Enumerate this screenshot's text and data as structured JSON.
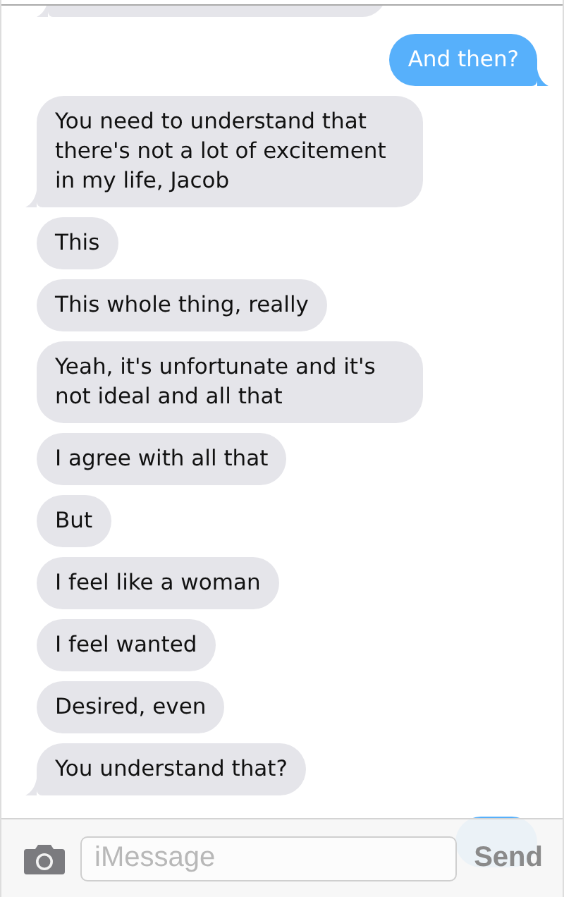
{
  "messages": [
    {
      "kind": "sent",
      "text": "And then?",
      "tail": true
    },
    {
      "kind": "received",
      "text": "You need to understand that there's not a lot of excitement in my life, Jacob",
      "tail": true
    },
    {
      "kind": "received",
      "text": "This",
      "tail": false
    },
    {
      "kind": "received",
      "text": "This whole thing, really",
      "tail": false
    },
    {
      "kind": "received",
      "text": "Yeah, it's unfortunate and it's not ideal and all that",
      "tail": false
    },
    {
      "kind": "received",
      "text": "I agree with all that",
      "tail": false
    },
    {
      "kind": "received",
      "text": "But",
      "tail": false
    },
    {
      "kind": "received",
      "text": "I feel like a woman",
      "tail": false
    },
    {
      "kind": "received",
      "text": "I feel wanted",
      "tail": false
    },
    {
      "kind": "received",
      "text": "Desired, even",
      "tail": false
    },
    {
      "kind": "received",
      "text": "You understand that?",
      "tail": true
    }
  ],
  "composer": {
    "placeholder": "iMessage",
    "send": "Send"
  }
}
